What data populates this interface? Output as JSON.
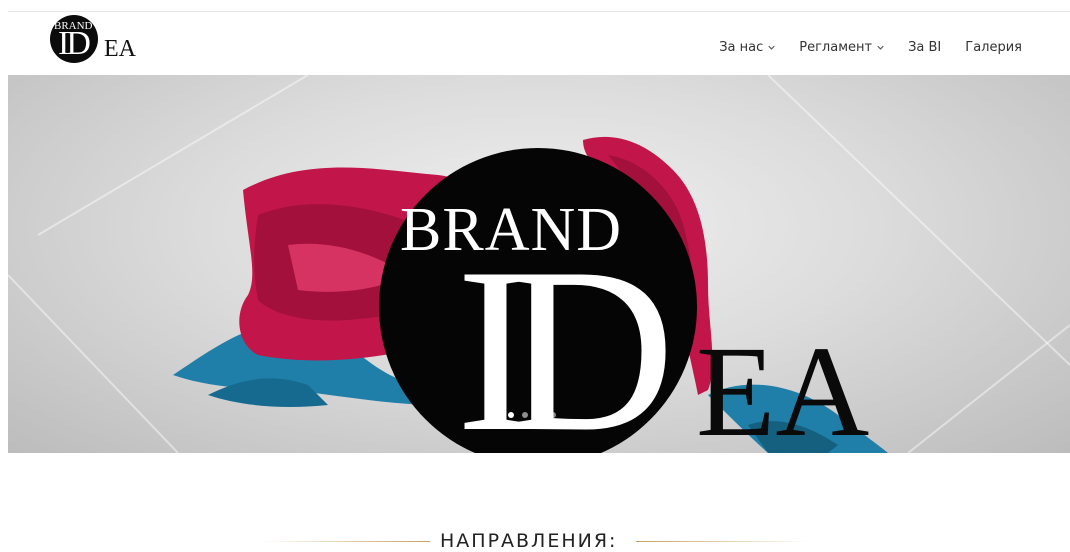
{
  "header": {
    "logo": {
      "top": "BRAND",
      "middle": "ID",
      "end": "EA"
    },
    "nav": [
      {
        "label": "За нас",
        "has_dropdown": true
      },
      {
        "label": "Регламент",
        "has_dropdown": true
      },
      {
        "label": "За BI",
        "has_dropdown": false
      },
      {
        "label": "Галерия",
        "has_dropdown": false
      }
    ]
  },
  "hero": {
    "logo": {
      "top": "BRAND",
      "middle": "ID",
      "end": "EA"
    },
    "slider": {
      "slide_count": 4,
      "active_slide": 1
    }
  },
  "section": {
    "title": "НАПРАВЛЕНИЯ:"
  },
  "colors": {
    "accent_gold": "#c8a05a",
    "fabric_red": "#c2164a",
    "fabric_blue": "#1f7fa8",
    "text": "#333333"
  }
}
